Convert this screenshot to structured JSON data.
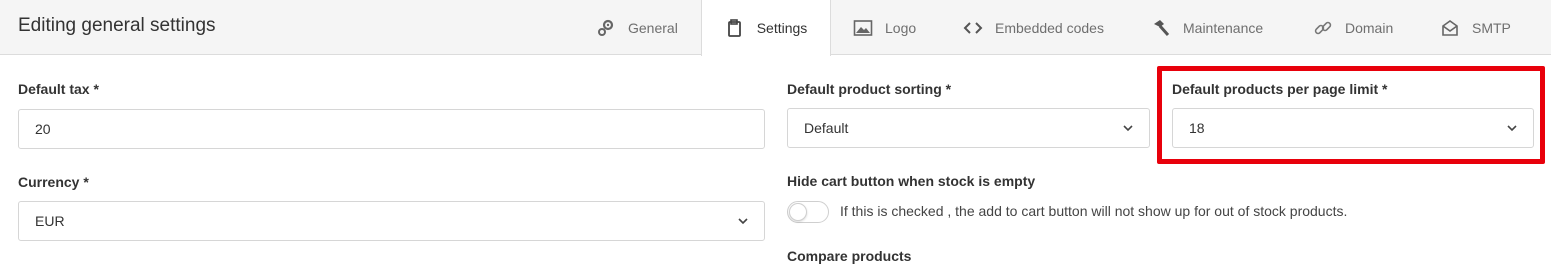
{
  "header": {
    "title": "Editing general settings",
    "tabs": [
      {
        "label": "General",
        "icon": "gears-icon"
      },
      {
        "label": "Settings",
        "icon": "clipboard-icon",
        "active": true
      },
      {
        "label": "Logo",
        "icon": "image-icon"
      },
      {
        "label": "Embedded codes",
        "icon": "code-icon"
      },
      {
        "label": "Maintenance",
        "icon": "hammer-icon"
      },
      {
        "label": "Domain",
        "icon": "link-icon"
      },
      {
        "label": "SMTP",
        "icon": "envelope-icon"
      }
    ]
  },
  "form": {
    "default_tax": {
      "label": "Default tax *",
      "value": "20"
    },
    "currency": {
      "label": "Currency *",
      "value": "EUR"
    },
    "default_sorting": {
      "label": "Default product sorting *",
      "value": "Default"
    },
    "per_page": {
      "label": "Default products per page limit *",
      "value": "18"
    },
    "hide_cart": {
      "label": "Hide cart button when stock is empty",
      "description": "If this is checked , the add to cart button will not show up for out of stock products.",
      "checked": false
    },
    "compare": {
      "label": "Compare products"
    }
  },
  "colors": {
    "highlight": "#e8000b",
    "topbar": "#f5f5f5"
  }
}
